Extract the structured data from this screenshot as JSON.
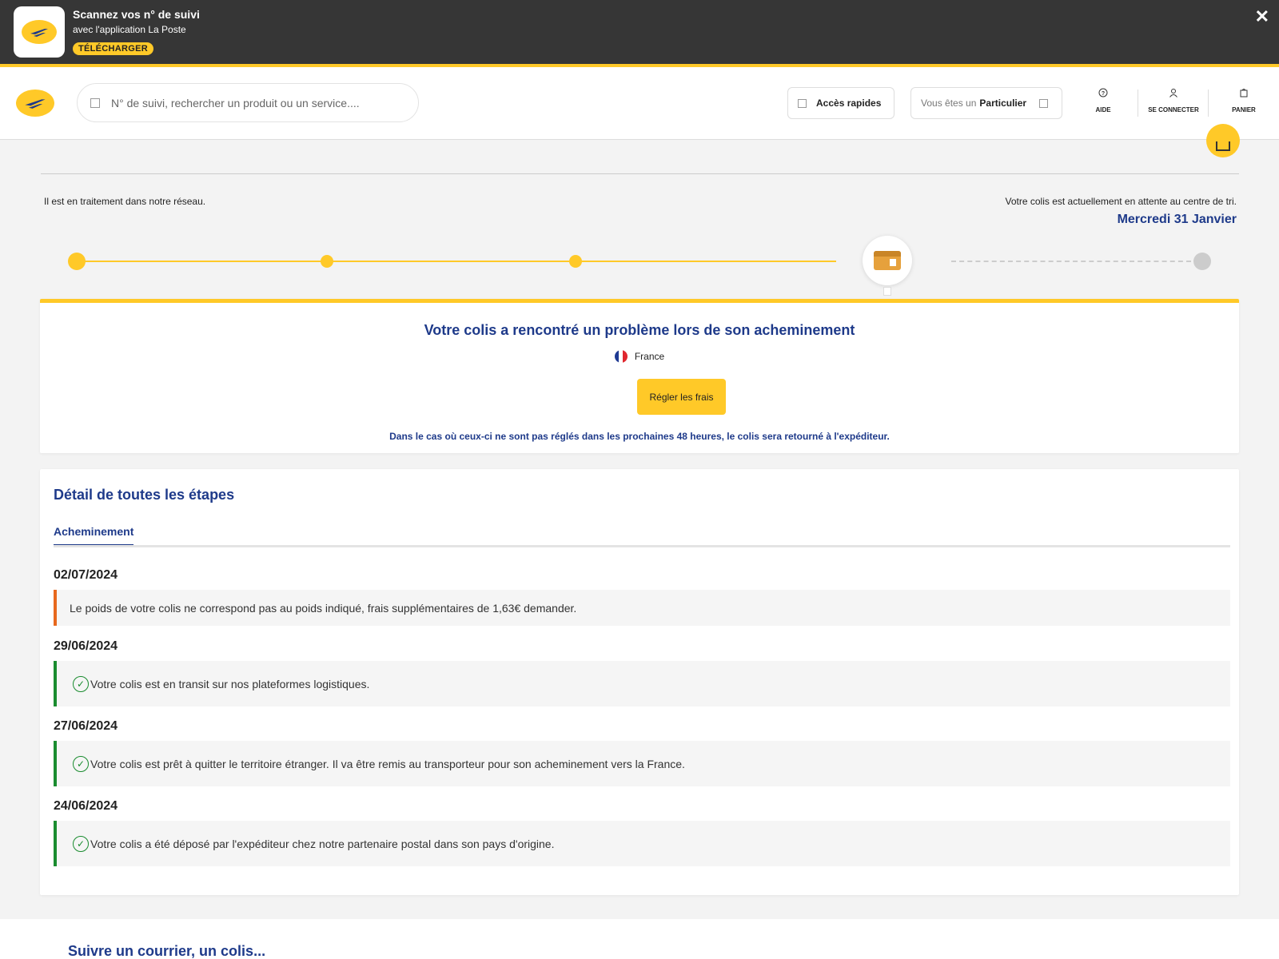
{
  "app_banner": {
    "title": "Scannez vos n° de suivi",
    "subtitle": "avec l'application La Poste",
    "cta": "TÉLÉCHARGER",
    "close": "✕"
  },
  "header": {
    "search_placeholder": "N° de suivi, rechercher un produit ou un service....",
    "quick_access": "Accès rapides",
    "user_prefix": "Vous êtes un",
    "user_type": "Particulier",
    "help": "AIDE",
    "login": "SE CONNECTER",
    "cart": "PANIER"
  },
  "tracking": {
    "status_left": "Il est en traitement dans notre réseau.",
    "status_right": "Votre colis est actuellement en attente au centre de tri.",
    "date": "Mercredi 31 Janvier",
    "progress_steps_total": 5,
    "progress_current_step": 4
  },
  "problem": {
    "title": "Votre colis a rencontré un problème lors de son acheminement",
    "country": "France",
    "pay_button": "Régler les frais",
    "note": "Dans le cas où ceux-ci ne sont pas réglés dans les prochaines 48 heures, le colis sera retourné à l'expéditeur."
  },
  "details": {
    "title": "Détail de toutes les étapes",
    "tab": "Acheminement",
    "events": [
      {
        "date": "02/07/2024",
        "text": "Le poids de votre colis ne correspond pas au poids indiqué, frais supplémentaires de 1,63€ demander.",
        "status": "warning"
      },
      {
        "date": "29/06/2024",
        "text": "Votre colis est en transit sur nos plateformes logistiques.",
        "status": "done"
      },
      {
        "date": "27/06/2024",
        "text": "Votre colis est prêt à quitter le territoire étranger. Il va être remis au transporteur pour son acheminement vers la France.",
        "status": "done"
      },
      {
        "date": "24/06/2024",
        "text": "Votre colis a été déposé par l'expéditeur chez notre partenaire postal dans son pays d'origine.",
        "status": "done"
      }
    ]
  },
  "footer": {
    "title": "Suivre un courrier, un colis..."
  },
  "colors": {
    "brand_yellow": "#ffc928",
    "brand_blue": "#1e3a8a",
    "success_green": "#1a8c2f",
    "warning_orange": "#e7681d"
  }
}
